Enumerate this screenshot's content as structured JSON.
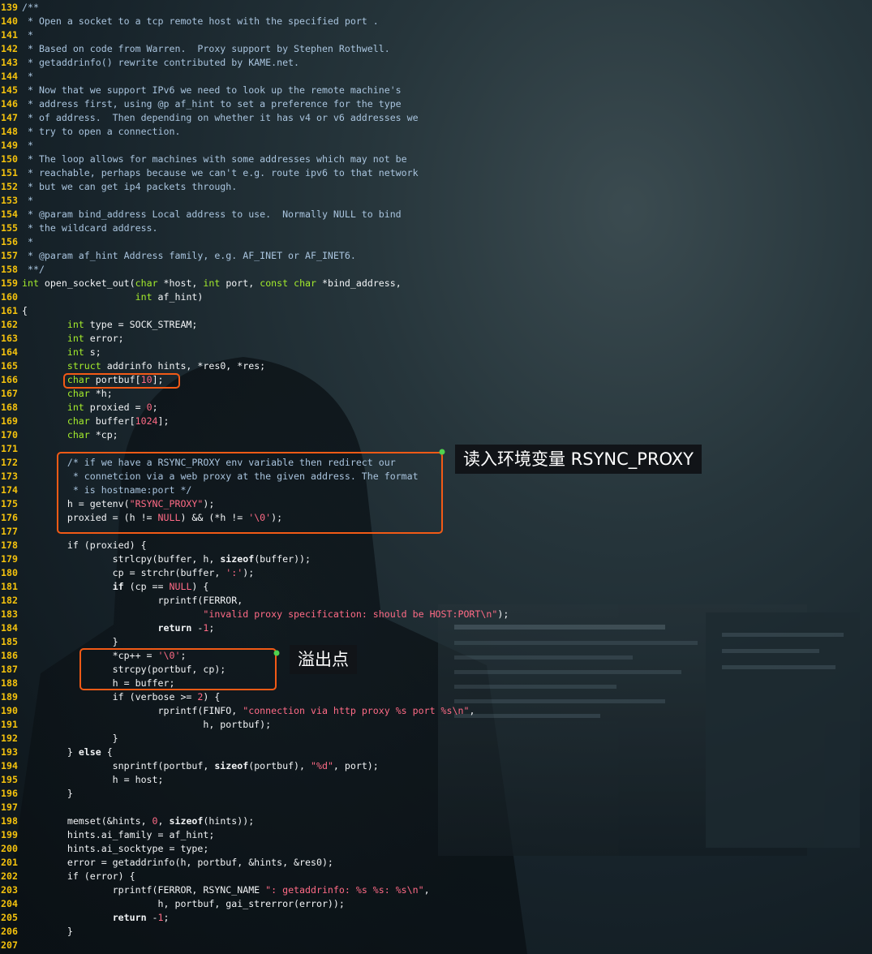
{
  "code_lines": [
    {
      "n": "139",
      "t": [
        [
          "cm",
          "/**"
        ]
      ]
    },
    {
      "n": "140",
      "t": [
        [
          "cm",
          " * Open a socket to a tcp remote host with the specified port ."
        ]
      ]
    },
    {
      "n": "141",
      "t": [
        [
          "cm",
          " *"
        ]
      ]
    },
    {
      "n": "142",
      "t": [
        [
          "cm",
          " * Based on code from Warren.  Proxy support by Stephen Rothwell."
        ]
      ]
    },
    {
      "n": "143",
      "t": [
        [
          "cm",
          " * getaddrinfo() rewrite contributed by KAME.net."
        ]
      ]
    },
    {
      "n": "144",
      "t": [
        [
          "cm",
          " *"
        ]
      ]
    },
    {
      "n": "145",
      "t": [
        [
          "cm",
          " * Now that we support IPv6 we need to look up the remote machine's"
        ]
      ]
    },
    {
      "n": "146",
      "t": [
        [
          "cm",
          " * address first, using @p af_hint to set a preference for the type"
        ]
      ]
    },
    {
      "n": "147",
      "t": [
        [
          "cm",
          " * of address.  Then depending on whether it has v4 or v6 addresses we"
        ]
      ]
    },
    {
      "n": "148",
      "t": [
        [
          "cm",
          " * try to open a connection."
        ]
      ]
    },
    {
      "n": "149",
      "t": [
        [
          "cm",
          " *"
        ]
      ]
    },
    {
      "n": "150",
      "t": [
        [
          "cm",
          " * The loop allows for machines with some addresses which may not be"
        ]
      ]
    },
    {
      "n": "151",
      "t": [
        [
          "cm",
          " * reachable, perhaps because we can't e.g. route ipv6 to that network"
        ]
      ]
    },
    {
      "n": "152",
      "t": [
        [
          "cm",
          " * but we can get ip4 packets through."
        ]
      ]
    },
    {
      "n": "153",
      "t": [
        [
          "cm",
          " *"
        ]
      ]
    },
    {
      "n": "154",
      "t": [
        [
          "cm",
          " * @param bind_address Local address to use.  Normally NULL to bind"
        ]
      ]
    },
    {
      "n": "155",
      "t": [
        [
          "cm",
          " * the wildcard address."
        ]
      ]
    },
    {
      "n": "156",
      "t": [
        [
          "cm",
          " *"
        ]
      ]
    },
    {
      "n": "157",
      "t": [
        [
          "cm",
          " * @param af_hint Address family, e.g. AF_INET or AF_INET6."
        ]
      ]
    },
    {
      "n": "158",
      "t": [
        [
          "cm",
          " **/"
        ]
      ]
    },
    {
      "n": "159",
      "t": [
        [
          "ty",
          "int"
        ],
        [
          "txt",
          " open_socket_out("
        ],
        [
          "ty",
          "char"
        ],
        [
          "txt",
          " *host, "
        ],
        [
          "ty",
          "int"
        ],
        [
          "txt",
          " port, "
        ],
        [
          "ty",
          "const char"
        ],
        [
          "txt",
          " *bind_address,"
        ]
      ]
    },
    {
      "n": "160",
      "t": [
        [
          "txt",
          "                    "
        ],
        [
          "ty",
          "int"
        ],
        [
          "txt",
          " af_hint)"
        ]
      ]
    },
    {
      "n": "161",
      "t": [
        [
          "txt",
          "{"
        ]
      ]
    },
    {
      "n": "162",
      "t": [
        [
          "txt",
          "        "
        ],
        [
          "ty",
          "int"
        ],
        [
          "txt",
          " type = SOCK_STREAM;"
        ]
      ]
    },
    {
      "n": "163",
      "t": [
        [
          "txt",
          "        "
        ],
        [
          "ty",
          "int"
        ],
        [
          "txt",
          " error;"
        ]
      ]
    },
    {
      "n": "164",
      "t": [
        [
          "txt",
          "        "
        ],
        [
          "ty",
          "int"
        ],
        [
          "txt",
          " s;"
        ]
      ]
    },
    {
      "n": "165",
      "t": [
        [
          "txt",
          "        "
        ],
        [
          "ty",
          "struct"
        ],
        [
          "txt",
          " addrinfo hints, *res0, *res;"
        ]
      ]
    },
    {
      "n": "166",
      "t": [
        [
          "txt",
          "        "
        ],
        [
          "ty",
          "char"
        ],
        [
          "txt",
          " portbuf["
        ],
        [
          "num",
          "10"
        ],
        [
          "txt",
          "];"
        ]
      ]
    },
    {
      "n": "167",
      "t": [
        [
          "txt",
          "        "
        ],
        [
          "ty",
          "char"
        ],
        [
          "txt",
          " *h;"
        ]
      ]
    },
    {
      "n": "168",
      "t": [
        [
          "txt",
          "        "
        ],
        [
          "ty",
          "int"
        ],
        [
          "txt",
          " proxied = "
        ],
        [
          "num",
          "0"
        ],
        [
          "txt",
          ";"
        ]
      ]
    },
    {
      "n": "169",
      "t": [
        [
          "txt",
          "        "
        ],
        [
          "ty",
          "char"
        ],
        [
          "txt",
          " buffer["
        ],
        [
          "num",
          "1024"
        ],
        [
          "txt",
          "];"
        ]
      ]
    },
    {
      "n": "170",
      "t": [
        [
          "txt",
          "        "
        ],
        [
          "ty",
          "char"
        ],
        [
          "txt",
          " *cp;"
        ]
      ]
    },
    {
      "n": "171",
      "t": [
        [
          "txt",
          ""
        ]
      ]
    },
    {
      "n": "172",
      "t": [
        [
          "txt",
          "        "
        ],
        [
          "cm",
          "/* if we have a RSYNC_PROXY env variable then redirect our"
        ]
      ]
    },
    {
      "n": "173",
      "t": [
        [
          "cm",
          "         * connetcion via a web proxy at the given address. The format"
        ]
      ]
    },
    {
      "n": "174",
      "t": [
        [
          "cm",
          "         * is hostname:port */"
        ]
      ]
    },
    {
      "n": "175",
      "t": [
        [
          "txt",
          "        h = getenv("
        ],
        [
          "str",
          "\"RSYNC_PROXY\""
        ],
        [
          "txt",
          ");"
        ]
      ]
    },
    {
      "n": "176",
      "t": [
        [
          "txt",
          "        proxied = (h != "
        ],
        [
          "num",
          "NULL"
        ],
        [
          "txt",
          ") && (*h != "
        ],
        [
          "str",
          "'\\0'"
        ],
        [
          "txt",
          ");"
        ]
      ]
    },
    {
      "n": "177",
      "t": [
        [
          "txt",
          ""
        ]
      ]
    },
    {
      "n": "178",
      "t": [
        [
          "txt",
          "        if (proxied) {"
        ]
      ]
    },
    {
      "n": "179",
      "t": [
        [
          "txt",
          "                strlcpy(buffer, h, "
        ],
        [
          "kw",
          "sizeof"
        ],
        [
          "txt",
          "(buffer));"
        ]
      ]
    },
    {
      "n": "180",
      "t": [
        [
          "txt",
          "                cp = strchr(buffer, "
        ],
        [
          "str",
          "':'"
        ],
        [
          "txt",
          ");"
        ]
      ]
    },
    {
      "n": "181",
      "t": [
        [
          "txt",
          "                "
        ],
        [
          "kw",
          "if"
        ],
        [
          "txt",
          " (cp == "
        ],
        [
          "num",
          "NULL"
        ],
        [
          "txt",
          ") {"
        ]
      ]
    },
    {
      "n": "182",
      "t": [
        [
          "txt",
          "                        rprintf(FERROR,"
        ]
      ]
    },
    {
      "n": "183",
      "t": [
        [
          "txt",
          "                                "
        ],
        [
          "str",
          "\"invalid proxy specification: should be HOST:PORT\\n\""
        ],
        [
          "txt",
          ");"
        ]
      ]
    },
    {
      "n": "184",
      "t": [
        [
          "txt",
          "                        "
        ],
        [
          "kw",
          "return"
        ],
        [
          "txt",
          " -"
        ],
        [
          "num",
          "1"
        ],
        [
          "txt",
          ";"
        ]
      ]
    },
    {
      "n": "185",
      "t": [
        [
          "txt",
          "                }"
        ]
      ]
    },
    {
      "n": "186",
      "t": [
        [
          "txt",
          "                *cp++ = "
        ],
        [
          "str",
          "'\\0'"
        ],
        [
          "txt",
          ";"
        ]
      ]
    },
    {
      "n": "187",
      "t": [
        [
          "txt",
          "                strcpy(portbuf, cp);"
        ]
      ]
    },
    {
      "n": "188",
      "t": [
        [
          "txt",
          "                h = buffer;"
        ]
      ]
    },
    {
      "n": "189",
      "t": [
        [
          "txt",
          "                if (verbose >= "
        ],
        [
          "num",
          "2"
        ],
        [
          "txt",
          ") {"
        ]
      ]
    },
    {
      "n": "190",
      "t": [
        [
          "txt",
          "                        rprintf(FINFO, "
        ],
        [
          "str",
          "\"connection via http proxy %s port %s\\n\""
        ],
        [
          "txt",
          ","
        ]
      ]
    },
    {
      "n": "191",
      "t": [
        [
          "txt",
          "                                h, portbuf);"
        ]
      ]
    },
    {
      "n": "192",
      "t": [
        [
          "txt",
          "                }"
        ]
      ]
    },
    {
      "n": "193",
      "t": [
        [
          "txt",
          "        } "
        ],
        [
          "kw",
          "else"
        ],
        [
          "txt",
          " {"
        ]
      ]
    },
    {
      "n": "194",
      "t": [
        [
          "txt",
          "                snprintf(portbuf, "
        ],
        [
          "kw",
          "sizeof"
        ],
        [
          "txt",
          "(portbuf), "
        ],
        [
          "str",
          "\"%d\""
        ],
        [
          "txt",
          ", port);"
        ]
      ]
    },
    {
      "n": "195",
      "t": [
        [
          "txt",
          "                h = host;"
        ]
      ]
    },
    {
      "n": "196",
      "t": [
        [
          "txt",
          "        }"
        ]
      ]
    },
    {
      "n": "197",
      "t": [
        [
          "txt",
          ""
        ]
      ]
    },
    {
      "n": "198",
      "t": [
        [
          "txt",
          "        memset(&hints, "
        ],
        [
          "num",
          "0"
        ],
        [
          "txt",
          ", "
        ],
        [
          "kw",
          "sizeof"
        ],
        [
          "txt",
          "(hints));"
        ]
      ]
    },
    {
      "n": "199",
      "t": [
        [
          "txt",
          "        hints.ai_family = af_hint;"
        ]
      ]
    },
    {
      "n": "200",
      "t": [
        [
          "txt",
          "        hints.ai_socktype = type;"
        ]
      ]
    },
    {
      "n": "201",
      "t": [
        [
          "txt",
          "        error = getaddrinfo(h, portbuf, &hints, &res0);"
        ]
      ]
    },
    {
      "n": "202",
      "t": [
        [
          "txt",
          "        if (error) {"
        ]
      ]
    },
    {
      "n": "203",
      "t": [
        [
          "txt",
          "                rprintf(FERROR, RSYNC_NAME "
        ],
        [
          "str",
          "\": getaddrinfo: %s %s: %s\\n\""
        ],
        [
          "txt",
          ","
        ]
      ]
    },
    {
      "n": "204",
      "t": [
        [
          "txt",
          "                        h, portbuf, gai_strerror(error));"
        ]
      ]
    },
    {
      "n": "205",
      "t": [
        [
          "txt",
          "                "
        ],
        [
          "kw",
          "return"
        ],
        [
          "txt",
          " -"
        ],
        [
          "num",
          "1"
        ],
        [
          "txt",
          ";"
        ]
      ]
    },
    {
      "n": "206",
      "t": [
        [
          "txt",
          "        }"
        ]
      ]
    },
    {
      "n": "207",
      "t": [
        [
          "txt",
          ""
        ]
      ]
    }
  ],
  "annotations": {
    "env_callout": "读入环境变量 RSYNC_PROXY",
    "overflow_callout": "溢出点"
  },
  "colors": {
    "line_number": "#f4c20d",
    "comment": "#a9c4de",
    "type_keyword": "#a4ec2c",
    "literal": "#ff6b86",
    "plain_text": "#f2f4f6",
    "highlight_box": "#f25a16",
    "marker_dot": "#4fd14f",
    "callout_bg": "#111418"
  }
}
